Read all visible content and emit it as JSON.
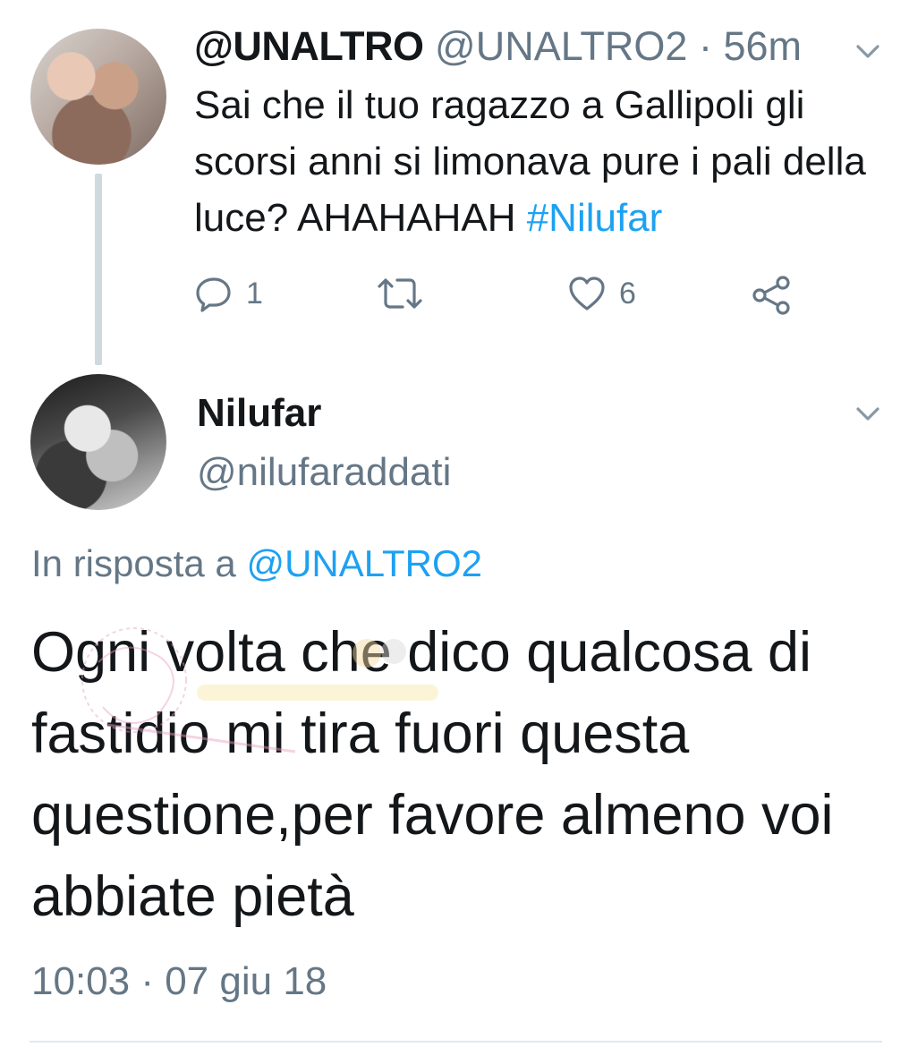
{
  "parent_tweet": {
    "display_name": "@UNALTRO",
    "handle": "@UNALTRO2",
    "separator": "·",
    "time_ago": "56m",
    "text_before_hashtag": "Sai che il tuo ragazzo a Gallipoli gli scorsi anni si limonava pure i pali della luce? AHAHAHAH ",
    "hashtag": "#Nilufar",
    "actions": {
      "reply_count": "1",
      "retweet_count": "",
      "like_count": "6"
    }
  },
  "reply_tweet": {
    "display_name": "Nilufar",
    "handle": "@nilufaraddati",
    "in_reply_prefix": "In risposta a ",
    "in_reply_handle": "@UNALTRO2",
    "text": "Ogni volta che dico qualcosa di fastidio mi tira fuori questa questione,per favore almeno voi abbiate pietà",
    "timestamp": "10:03 · 07 giu 18"
  },
  "colors": {
    "link": "#1da1f2",
    "secondary_text": "#657786",
    "primary_text": "#14171a",
    "thread_line": "#cfd9de"
  },
  "icons": [
    "chevron-down-icon",
    "reply-icon",
    "retweet-icon",
    "like-icon",
    "share-icon"
  ]
}
